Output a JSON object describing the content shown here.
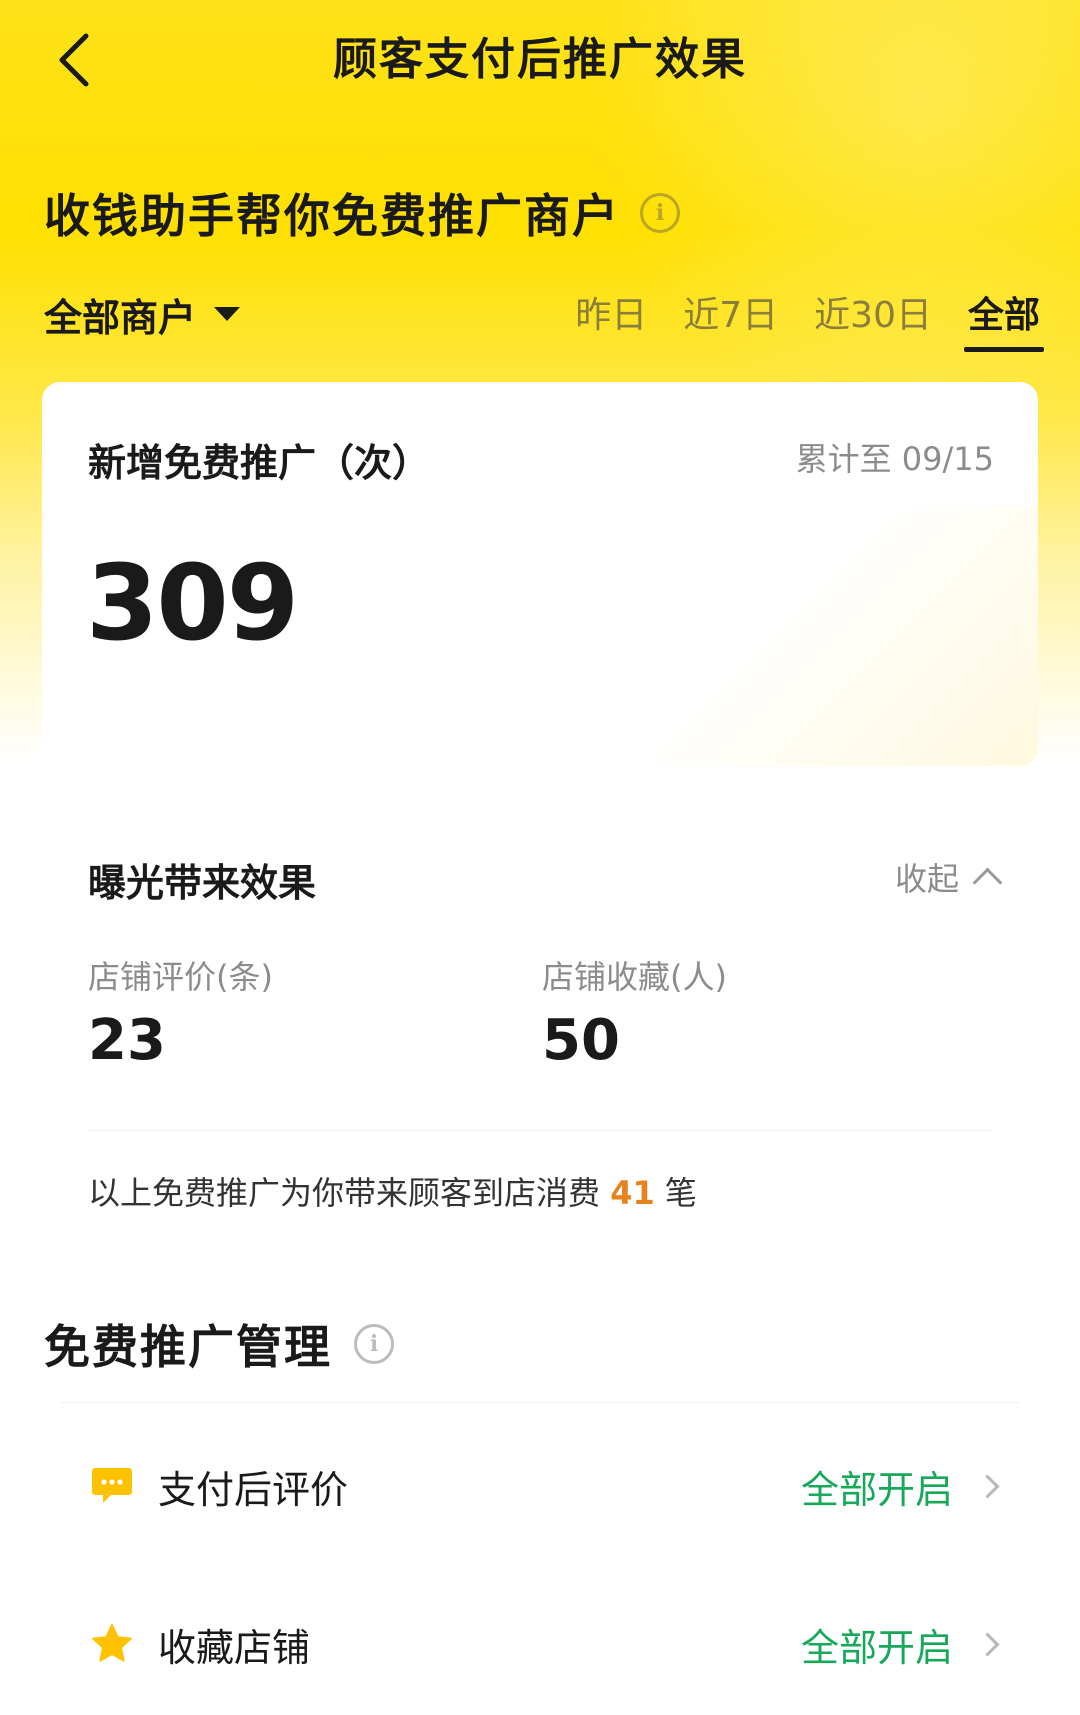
{
  "header": {
    "title": "顾客支付后推广效果"
  },
  "headline": {
    "text": "收钱助手帮你免费推广商户"
  },
  "filters": {
    "merchant": "全部商户",
    "tabs": [
      {
        "label": "昨日",
        "active": false
      },
      {
        "label": "近7日",
        "active": false
      },
      {
        "label": "近30日",
        "active": false
      },
      {
        "label": "全部",
        "active": true
      }
    ]
  },
  "promo_card": {
    "label": "新增免费推广（次）",
    "date_note": "累计至 09/15",
    "value": "309"
  },
  "effect_card": {
    "title": "曝光带来效果",
    "collapse_label": "收起",
    "stats": [
      {
        "label": "店铺评价(条)",
        "value": "23"
      },
      {
        "label": "店铺收藏(人)",
        "value": "50"
      }
    ],
    "summary_prefix": "以上免费推广为你带来顾客到店消费 ",
    "summary_count": "41",
    "summary_suffix": " 笔"
  },
  "management": {
    "title": "免费推广管理",
    "items": [
      {
        "label": "支付后评价",
        "status": "全部开启",
        "icon": "comment-icon"
      },
      {
        "label": "收藏店铺",
        "status": "全部开启",
        "icon": "star-icon"
      }
    ]
  },
  "colors": {
    "brand_yellow": "#ffe000",
    "status_green": "#17a85a",
    "highlight_orange": "#e8821e"
  }
}
